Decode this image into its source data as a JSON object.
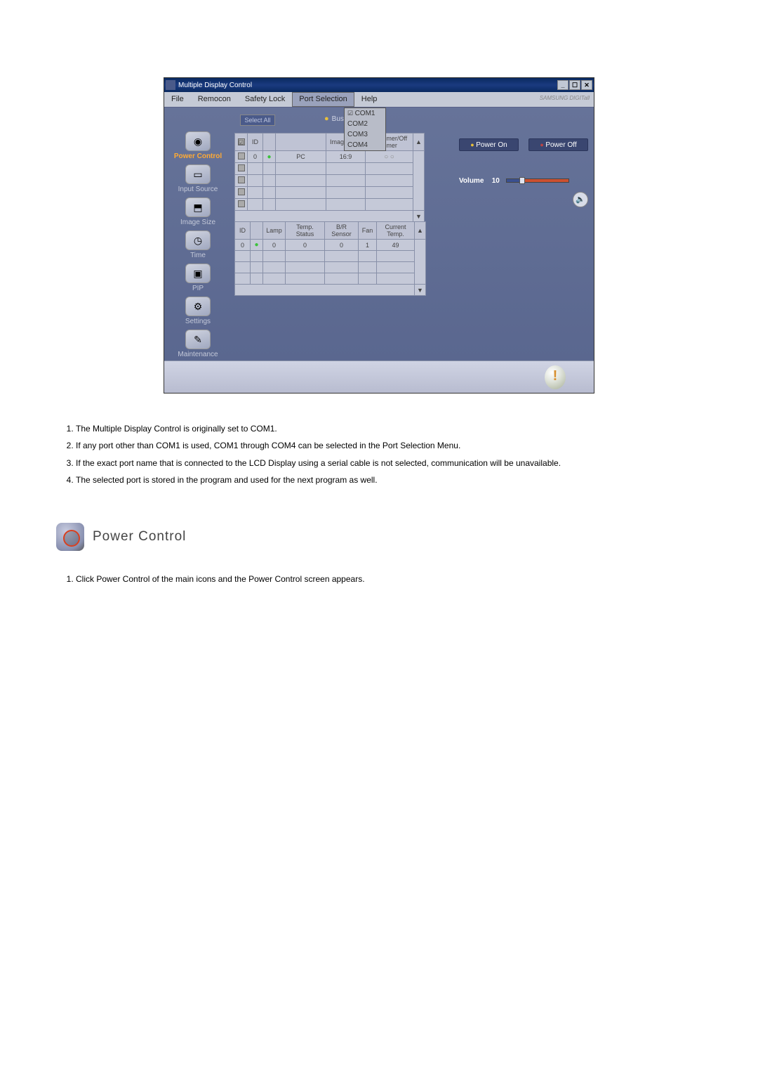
{
  "window": {
    "title": "Multiple Display Control",
    "brand": "SAMSUNG DIGITall"
  },
  "menu": {
    "file": "File",
    "remocon": "Remocon",
    "safety": "Safety Lock",
    "port": "Port Selection",
    "help": "Help"
  },
  "ports": [
    "COM1",
    "COM2",
    "COM3",
    "COM4"
  ],
  "selected_port_index": 0,
  "select_all": "Select All",
  "busy_label": "Busy",
  "sidebar": [
    {
      "label": "Power Control",
      "active": true
    },
    {
      "label": "Input Source",
      "active": false
    },
    {
      "label": "Image Size",
      "active": false
    },
    {
      "label": "Time",
      "active": false
    },
    {
      "label": "PIP",
      "active": false
    },
    {
      "label": "Settings",
      "active": false
    },
    {
      "label": "Maintenance",
      "active": false
    }
  ],
  "table1": {
    "headers": [
      "",
      "ID",
      "",
      "",
      "Image Size",
      "On Timer/Off Timer"
    ],
    "rows": [
      {
        "id": "0",
        "status": "green",
        "source": "PC",
        "imgsize": "16:9",
        "timer": "○"
      }
    ]
  },
  "table2": {
    "headers": [
      "ID",
      "",
      "Lamp",
      "Temp. Status",
      "B/R Sensor",
      "Fan",
      "Current Temp."
    ],
    "rows": [
      {
        "id": "0",
        "stat": "green",
        "lamp": "0",
        "temp": "0",
        "br": "0",
        "fan": "1",
        "cur": "49"
      }
    ]
  },
  "power": {
    "on": "Power On",
    "off": "Power Off",
    "volume_label": "Volume",
    "volume_value": "10"
  },
  "doc": {
    "items": [
      "The Multiple Display Control is originally set to COM1.",
      "If any port other than COM1 is used, COM1 through COM4 can be selected in the Port Selection Menu.",
      "If the exact port name that is connected to the LCD Display using a serial cable is not selected, communication will be unavailable.",
      "The selected port is stored in the program and used for the next program as well."
    ],
    "section_title": "Power Control",
    "pc_items": [
      "Click Power Control of the main icons and the Power Control screen appears."
    ]
  }
}
